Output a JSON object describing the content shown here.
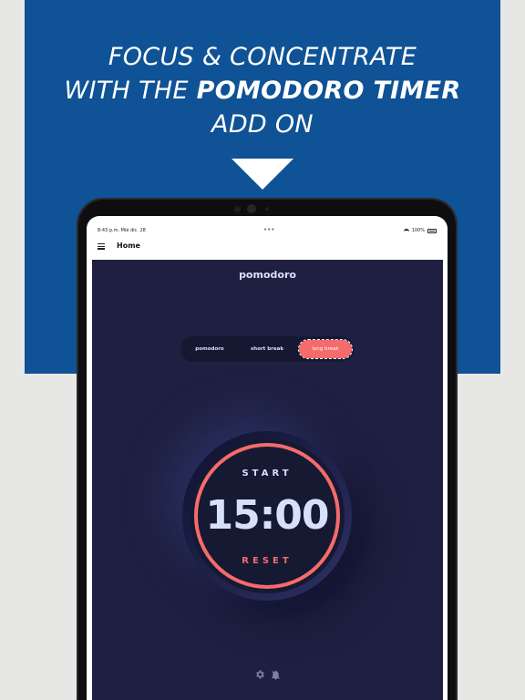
{
  "promo": {
    "line1": "FOCUS & CONCENTRATE",
    "line2_prefix": "WITH THE ",
    "line2_bold": "POMODORO TIMER",
    "line3": "ADD ON"
  },
  "status_bar": {
    "time": "8:43 p.m.   Mié dic. 28",
    "dots": "•••",
    "battery": "100%"
  },
  "app_bar": {
    "title": "Home"
  },
  "pomodoro": {
    "brand": "pomodoro",
    "modes": [
      {
        "label": "pomodoro",
        "active": false
      },
      {
        "label": "short break",
        "active": false
      },
      {
        "label": "long break",
        "active": true
      }
    ],
    "start_label": "START",
    "time": "15:00",
    "reset_label": "RESET"
  },
  "icons": {
    "settings": "gear-icon",
    "notifications": "bell-off-icon"
  },
  "colors": {
    "banner": "#0f5295",
    "app_bg": "#1f2041",
    "accent": "#f56b6b",
    "text": "#d7e0fa"
  }
}
